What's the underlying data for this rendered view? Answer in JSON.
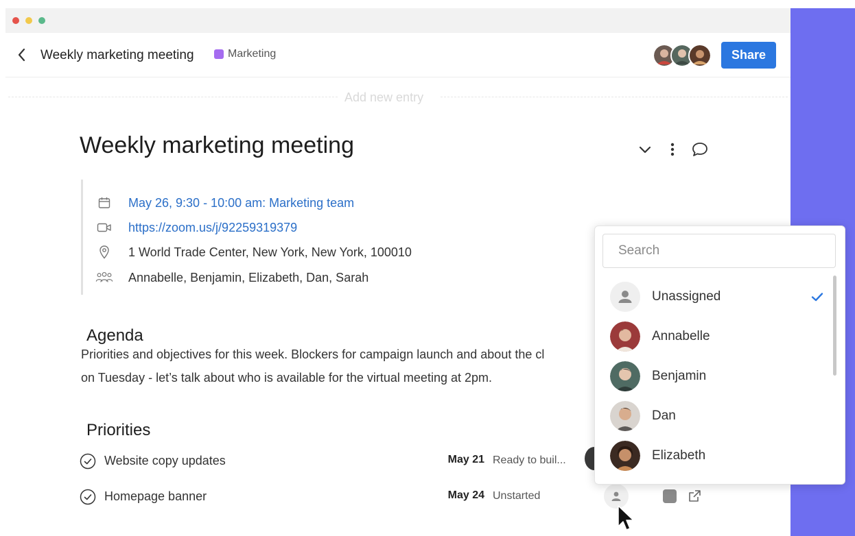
{
  "header": {
    "title": "Weekly marketing meeting",
    "tag_label": "Marketing",
    "share_label": "Share"
  },
  "add_entry": {
    "label": "Add new entry"
  },
  "document": {
    "title": "Weekly marketing meeting",
    "details": {
      "datetime": "May 26, 9:30 - 10:00 am: Marketing team",
      "meeting_link": "https://zoom.us/j/92259319379",
      "location": "1 World Trade Center, New York, New York, 100010",
      "attendees": "Annabelle, Benjamin, Elizabeth, Dan, Sarah"
    },
    "agenda": {
      "heading": "Agenda",
      "line1": "Priorities and objectives for this week. Blockers for campaign launch and about the cl",
      "line2": "on Tuesday - let’s talk about who is available for the virtual meeting at 2pm."
    },
    "priorities": {
      "heading": "Priorities",
      "items": [
        {
          "name": "Website copy updates",
          "date": "May 21",
          "status": "Ready to buil..."
        },
        {
          "name": "Homepage banner",
          "date": "May 24",
          "status": "Unstarted"
        }
      ]
    }
  },
  "assignee_dropdown": {
    "search_placeholder": "Search",
    "options": [
      {
        "label": "Unassigned",
        "selected": true
      },
      {
        "label": "Annabelle",
        "selected": false
      },
      {
        "label": "Benjamin",
        "selected": false
      },
      {
        "label": "Dan",
        "selected": false
      },
      {
        "label": "Elizabeth",
        "selected": false
      }
    ]
  },
  "colors": {
    "accent_panel": "#6e6ef0",
    "share_button": "#2b77e0",
    "link": "#2b6fc8",
    "tag_swatch": "#a56cf0",
    "check": "#2b77e0"
  },
  "icons": {
    "back": "chevron-left-icon",
    "collapse": "chevron-down-icon",
    "more": "vertical-dots-icon",
    "comment": "speech-bubble-icon",
    "date": "calendar-icon",
    "video": "video-camera-icon",
    "location": "map-pin-icon",
    "attendees": "people-icon",
    "task": "circle-check-icon",
    "unassigned": "person-icon",
    "open": "external-link-icon",
    "pointer": "mouse-cursor-icon"
  }
}
